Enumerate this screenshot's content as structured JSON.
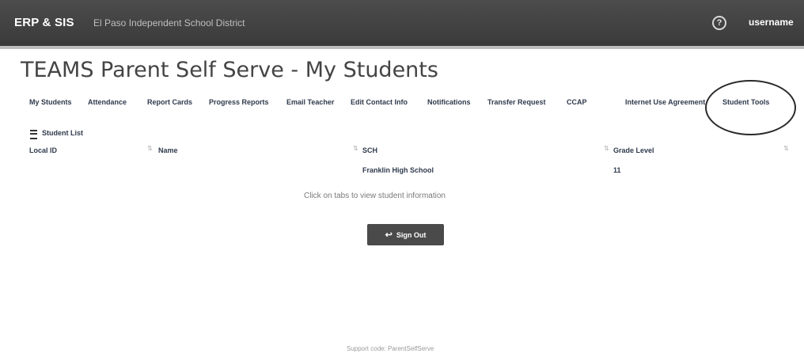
{
  "header": {
    "brand": "ERP & SIS",
    "district": "El Paso Independent School District",
    "help_icon_glyph": "?",
    "user": "username"
  },
  "page_title": "TEAMS Parent Self Serve - My Students",
  "tabs": [
    "My Students",
    "Attendance",
    "Report Cards",
    "Progress Reports",
    "Email Teacher",
    "Edit Contact Info",
    "Notifications",
    "Transfer Request",
    "CCAP",
    "Internet Use Agreement",
    "Student Tools"
  ],
  "student_list": {
    "title": "Student List",
    "columns": [
      "Local ID",
      "Name",
      "SCH",
      "Grade Level"
    ],
    "rows": [
      {
        "local_id": "",
        "name": "",
        "school": "Franklin High School",
        "grade": "11"
      }
    ]
  },
  "hint": "Click on tabs to view student information",
  "signout_label": "Sign Out",
  "footer": "Support code: ParentSelfServe"
}
